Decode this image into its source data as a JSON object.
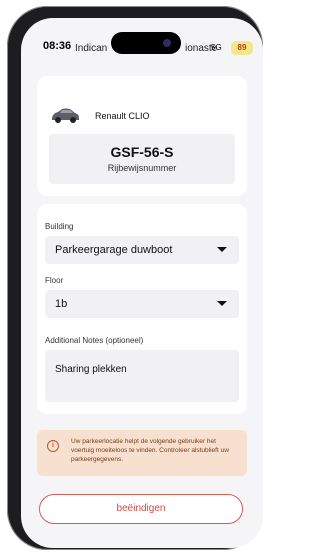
{
  "status_bar": {
    "time": "08:36",
    "carrier_left": "Indican",
    "carrier_right": "ionaste",
    "signal": "5G",
    "battery": "89"
  },
  "vehicle": {
    "name": "Renault CLIO",
    "license_plate": "GSF-56-S",
    "license_label": "Rijbewijsnummer"
  },
  "form": {
    "building_label": "Building",
    "building_value": "Parkeergarage duwboot",
    "floor_label": "Floor",
    "floor_value": "1b",
    "notes_label": "Additional Notes (optioneel)",
    "notes_value": "Sharing plekken"
  },
  "alert": {
    "icon": "info-icon",
    "text": "Uw parkeerlocatie helpt de volgende gebruiker het voertuig moeiteloos te vinden. Controleer alstublieft uw parkeergegevens."
  },
  "actions": {
    "end_label": "beëindigen"
  },
  "colors": {
    "accent_red": "#d14b3f",
    "alert_bg": "#f8e0d0",
    "screen_bg": "#f5f5f7"
  }
}
